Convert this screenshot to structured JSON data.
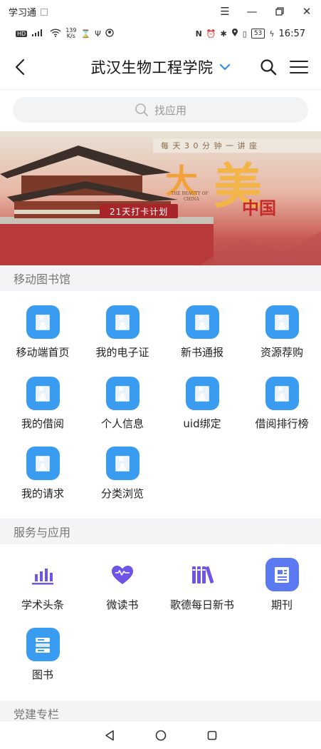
{
  "window": {
    "title": "学习通"
  },
  "status_bar": {
    "net_speed": "139",
    "net_unit": "K/s",
    "battery": "53",
    "time": "16:57"
  },
  "header": {
    "title": "武汉生物工程学院"
  },
  "search": {
    "placeholder": "找应用"
  },
  "banner": {
    "top_text": "每 天 3 0 分 钟 一 讲 座",
    "big_1": "大",
    "big_2": "美",
    "en_line1": "THE BEAUTY OF",
    "en_line2": "CHINA",
    "china": "中国",
    "plan": "21天打卡计划"
  },
  "sections": {
    "library": {
      "title": "移动图书馆",
      "items": [
        {
          "label": "移动端首页"
        },
        {
          "label": "我的电子证"
        },
        {
          "label": "新书通报"
        },
        {
          "label": "资源荐购"
        },
        {
          "label": "我的借阅"
        },
        {
          "label": "个人信息"
        },
        {
          "label": "uid绑定"
        },
        {
          "label": "借阅排行榜"
        },
        {
          "label": "我的请求"
        },
        {
          "label": "分类浏览"
        }
      ]
    },
    "services": {
      "title": "服务与应用",
      "items": [
        {
          "label": "学术头条",
          "icon": "bar-chart-icon"
        },
        {
          "label": "微读书",
          "icon": "heart-wave-icon"
        },
        {
          "label": "歌德每日新书",
          "icon": "books-icon"
        },
        {
          "label": "期刊",
          "icon": "journal-icon"
        },
        {
          "label": "图书",
          "icon": "book-stack-icon"
        }
      ]
    },
    "party": {
      "title": "党建专栏"
    }
  },
  "colors": {
    "accent": "#3a9cf0",
    "purple": "#6e55e6",
    "chevron": "#2f8fe8"
  }
}
